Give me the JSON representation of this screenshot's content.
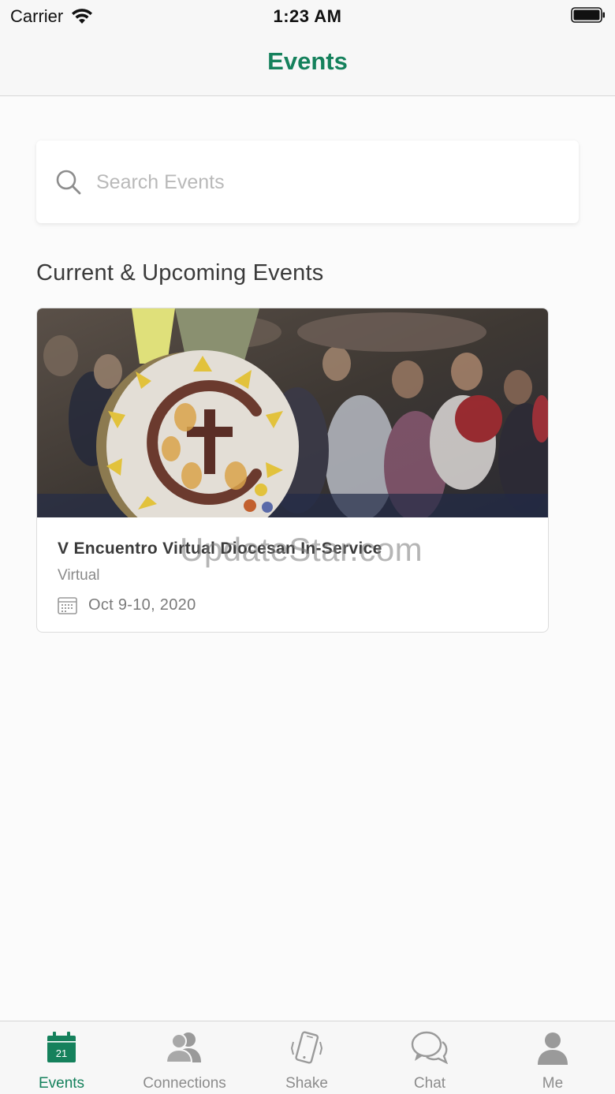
{
  "status_bar": {
    "carrier": "Carrier",
    "time": "1:23 AM"
  },
  "header": {
    "title": "Events"
  },
  "search": {
    "placeholder": "Search Events",
    "value": ""
  },
  "section": {
    "title": "Current & Upcoming Events"
  },
  "events": [
    {
      "name": "V Encuentro Virtual Diocesan In-Service",
      "location": "Virtual",
      "date": "Oct 9-10, 2020"
    }
  ],
  "watermark": "UpdateStar.com",
  "tab_bar": {
    "tabs": [
      {
        "label": "Events",
        "icon": "calendar-icon",
        "calendar_day": "21",
        "active": true
      },
      {
        "label": "Connections",
        "icon": "people-icon",
        "active": false
      },
      {
        "label": "Shake",
        "icon": "shake-phone-icon",
        "active": false
      },
      {
        "label": "Chat",
        "icon": "chat-bubbles-icon",
        "active": false
      },
      {
        "label": "Me",
        "icon": "person-icon",
        "active": false
      }
    ]
  },
  "colors": {
    "accent": "#15815c",
    "inactive": "#8c8c8c",
    "background": "#fbfbfb"
  }
}
